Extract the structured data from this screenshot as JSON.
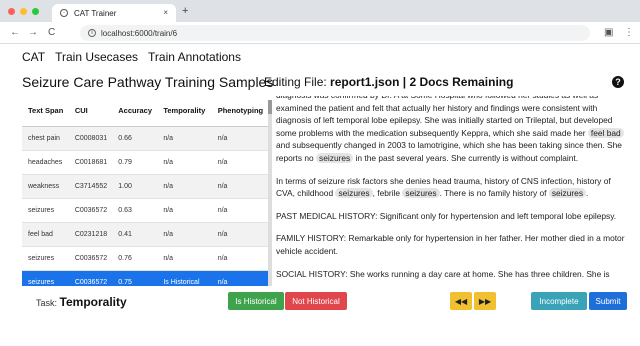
{
  "browser": {
    "tab_title": "CAT Trainer",
    "tab_close": "×",
    "new_tab": "+",
    "url": "localhost:6000/train/6",
    "back": "←",
    "forward": "→",
    "reload": "C",
    "info": "i"
  },
  "nav": {
    "items": [
      "CAT",
      "Train Usecases",
      "Train Annotations"
    ]
  },
  "page_title": "Seizure Care Pathway Training Samples",
  "editing": {
    "prefix": "Editing File:",
    "file": "report1.json",
    "sep": " | ",
    "remaining": "2 Docs Remaining"
  },
  "help_icon": "?",
  "table": {
    "headers": [
      "Text Span",
      "CUI",
      "Accuracy",
      "Temporality",
      "Phenotyping"
    ],
    "rows": [
      [
        "chest pain",
        "C0008031",
        "0.66",
        "n/a",
        "n/a"
      ],
      [
        "headaches",
        "C0018681",
        "0.79",
        "n/a",
        "n/a"
      ],
      [
        "weakness",
        "C3714552",
        "1.00",
        "n/a",
        "n/a"
      ],
      [
        "seizures",
        "C0036572",
        "0.63",
        "n/a",
        "n/a"
      ],
      [
        "feel bad",
        "C0231218",
        "0.41",
        "n/a",
        "n/a"
      ],
      [
        "seizures",
        "C0036572",
        "0.76",
        "n/a",
        "n/a"
      ],
      [
        "seizures",
        "C0036572",
        "0.75",
        "Is Historical",
        "n/a"
      ]
    ]
  },
  "doc": {
    "p1_a": "diagnosis was confirmed by Dr. A at Some Hospital who followed her studies as well as examined the patient and felt that actually her history and findings were consistent with diagnosis of left temporal lobe epilepsy. She was initially started on Trileptal, but developed some problems with the medication subsequently Keppra, which she said made her",
    "p1_ann1": "feel bad",
    "p1_b": "and subsequently changed in 2003 to lamotrigine, which she has been taking since then. She reports no",
    "p1_ann2": "seizures",
    "p1_c": "in the past several years. She currently is without complaint.",
    "p2_a": "In terms of seizure risk factors she denies head trauma, history of CNS infection, history of CVA, childhood",
    "p2_ann1": "seizures",
    "p2_b": ", febrile",
    "p2_ann2": "seizures",
    "p2_c": ". There is no family history of",
    "p2_ann3": "seizures",
    "p2_d": ".",
    "p3": "PAST MEDICAL HISTORY: Significant only for hypertension and left temporal lobe epilepsy.",
    "p4": "FAMILY HISTORY: Remarkable only for hypertension in her father. Her mother died in a motor vehicle accident.",
    "p5": "SOCIAL HISTORY: She works running a day care at home. She has three children. She is"
  },
  "footer": {
    "task_label": "Task:",
    "task_name": "Temporality",
    "btn_historical": "Is Historical",
    "btn_not_historical": "Not Historical",
    "btn_prev": "◀◀",
    "btn_next": "▶▶",
    "btn_incomplete": "Incomplete",
    "btn_submit": "Submit"
  },
  "colors": {
    "selected_row": "#1a73e8",
    "historical": "#3fa34d",
    "not_historical": "#e0474c",
    "nav_arrows": "#f0c030",
    "incomplete": "#3aa3b8",
    "submit": "#1f6fdb"
  }
}
